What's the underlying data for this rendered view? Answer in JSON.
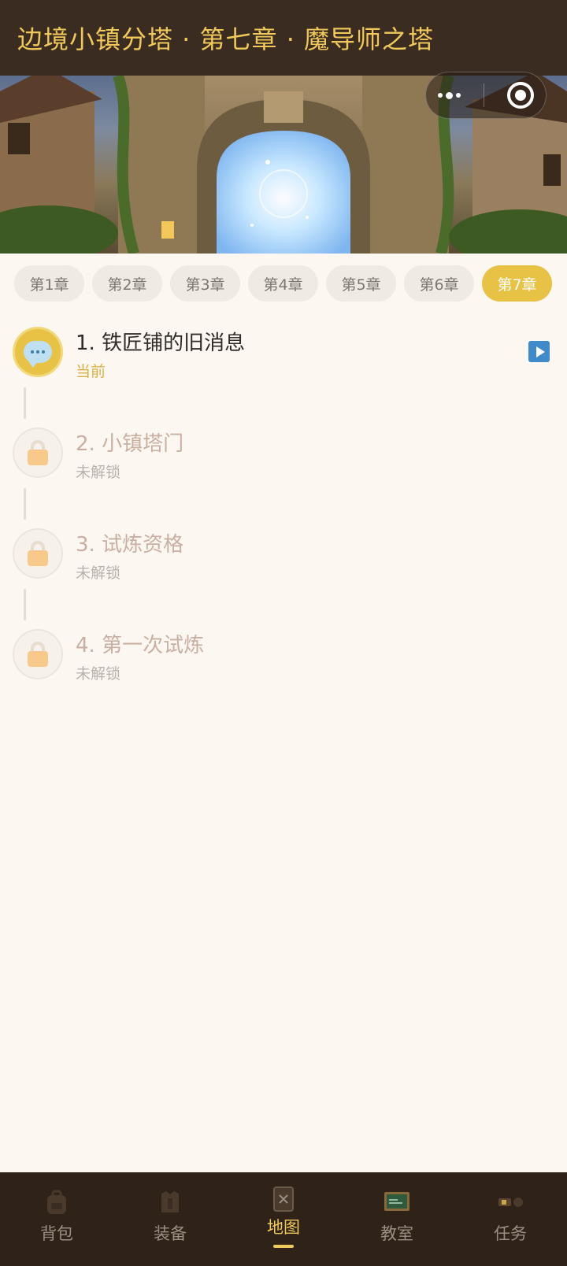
{
  "header": {
    "title": "边境小镇分塔 · 第七章 · 魔导师之塔"
  },
  "capsule": {
    "more_icon": "more-dots-icon",
    "close_icon": "target-icon"
  },
  "chapters": {
    "tabs": [
      {
        "label": "第1章",
        "active": false
      },
      {
        "label": "第2章",
        "active": false
      },
      {
        "label": "第3章",
        "active": false
      },
      {
        "label": "第4章",
        "active": false
      },
      {
        "label": "第5章",
        "active": false
      },
      {
        "label": "第6章",
        "active": false
      },
      {
        "label": "第7章",
        "active": true
      }
    ]
  },
  "levels": [
    {
      "title": "1. 铁匠铺的旧消息",
      "status": "当前",
      "state": "current",
      "icon": "chat-bubble-icon"
    },
    {
      "title": "2. 小镇塔门",
      "status": "未解锁",
      "state": "locked",
      "icon": "lock-icon"
    },
    {
      "title": "3. 试炼资格",
      "status": "未解锁",
      "state": "locked",
      "icon": "lock-icon"
    },
    {
      "title": "4. 第一次试炼",
      "status": "未解锁",
      "state": "locked",
      "icon": "lock-icon"
    }
  ],
  "bottom_nav": {
    "items": [
      {
        "label": "背包",
        "icon": "backpack-icon",
        "active": false
      },
      {
        "label": "装备",
        "icon": "armor-icon",
        "active": false
      },
      {
        "label": "地图",
        "icon": "map-icon",
        "active": true
      },
      {
        "label": "教室",
        "icon": "blackboard-icon",
        "active": false
      },
      {
        "label": "任务",
        "icon": "scroll-icon",
        "active": false
      }
    ]
  },
  "colors": {
    "accent": "#e8c244",
    "header_bg": "#3a2c20",
    "page_bg": "#fcf8f1",
    "title_gold": "#f0c95a",
    "play_blue": "#3f8bc9"
  }
}
